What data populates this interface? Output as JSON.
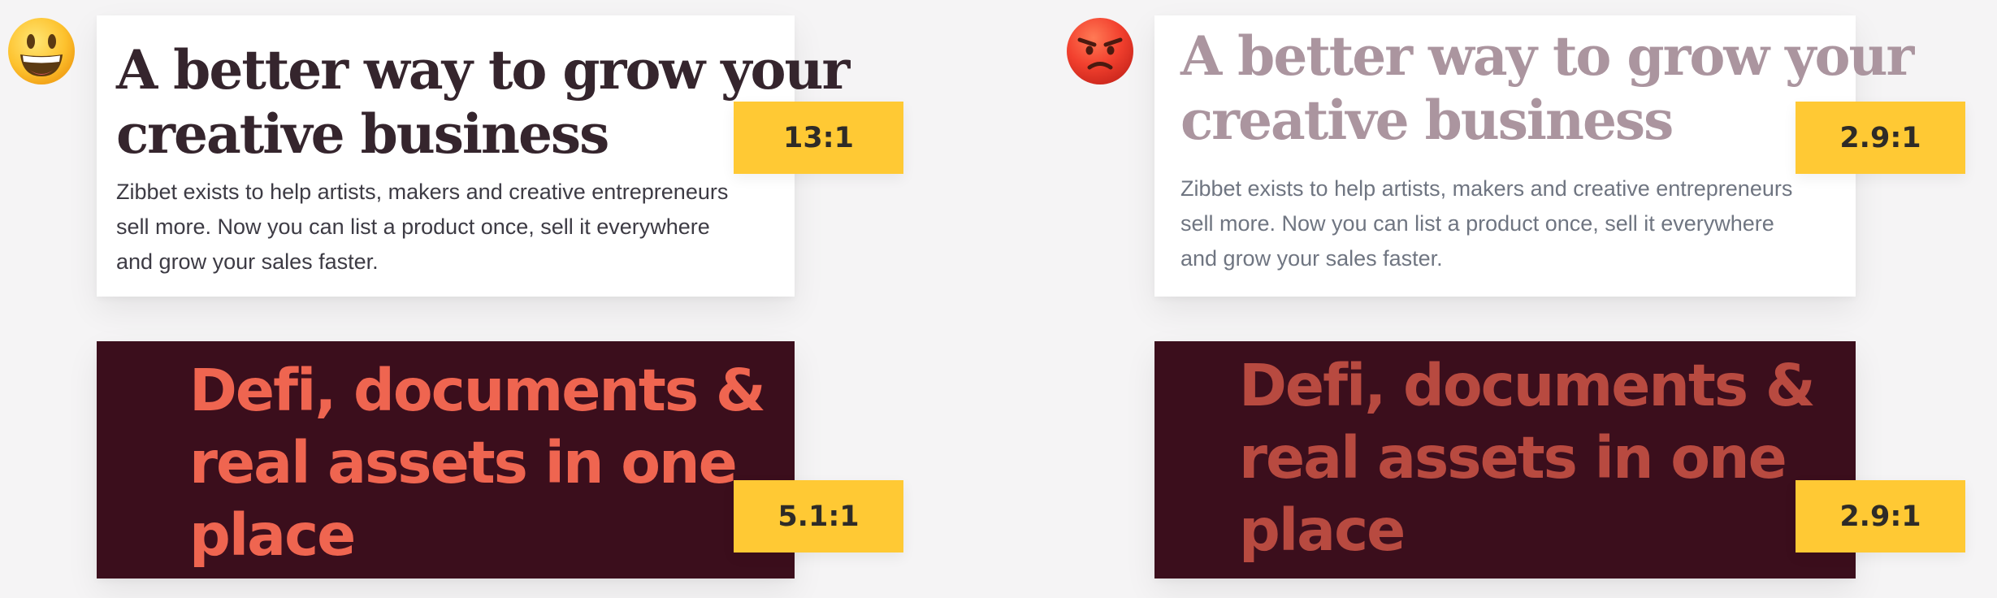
{
  "comparisons": [
    {
      "side": "good",
      "emoji": "grinning-face-icon",
      "light_card": {
        "headline_line1": "A better way to grow your",
        "headline_line2": "creative business",
        "body_line1": "Zibbet exists to help artists, makers and creative entrepreneurs",
        "body_line2": "sell more. Now you can list a product once, sell it everywhere",
        "body_line3": "and grow your sales faster.",
        "ratio": "13:1",
        "headline_color": "#35252d",
        "body_color": "#3d3b44"
      },
      "dark_card": {
        "line1": "Defi, documents &",
        "line2": "real assets in one",
        "line3": "place",
        "ratio": "5.1:1",
        "text_color": "#ef6550",
        "background": "#3b0e1c"
      }
    },
    {
      "side": "bad",
      "emoji": "angry-face-icon",
      "light_card": {
        "headline_line1": "A better way to grow your",
        "headline_line2": "creative business",
        "body_line1": "Zibbet exists to help artists, makers and creative entrepreneurs",
        "body_line2": "sell more. Now you can list a product once, sell it everywhere",
        "body_line3": "and grow your sales faster.",
        "ratio": "2.9:1",
        "headline_color": "#ab959f",
        "body_color": "#6f7581"
      },
      "dark_card": {
        "line1": "Defi, documents &",
        "line2": "real assets in one",
        "line3": "place",
        "ratio": "2.9:1",
        "text_color": "#b84a40",
        "background": "#3b0e1c"
      }
    }
  ],
  "colors": {
    "page_background": "#f5f4f5",
    "badge": "#ffc934",
    "badge_text": "#2e2b27"
  }
}
